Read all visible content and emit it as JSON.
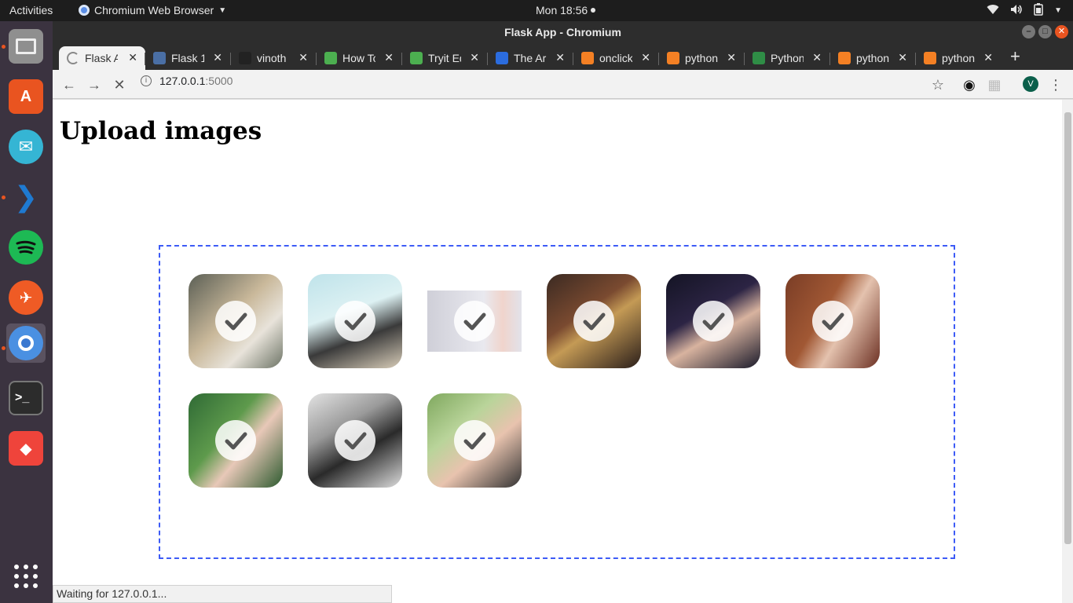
{
  "topbar": {
    "activities": "Activities",
    "app": "Chromium Web Browser",
    "clock": "Mon 18:56"
  },
  "dock": {
    "items": [
      {
        "name": "files",
        "color": "#8a8a8a"
      },
      {
        "name": "software",
        "color": "#e95420"
      },
      {
        "name": "mail",
        "color": "#35b5d4"
      },
      {
        "name": "vscode",
        "color": "#1f7ad1"
      },
      {
        "name": "spotify",
        "color": "#1db954"
      },
      {
        "name": "postman",
        "color": "#ef5b25"
      },
      {
        "name": "chromium",
        "color": "#4a90e2"
      },
      {
        "name": "terminal",
        "color": "#2c2c2c"
      },
      {
        "name": "anydesk",
        "color": "#ef443b"
      }
    ]
  },
  "window": {
    "title": "Flask App - Chromium"
  },
  "tabs": [
    {
      "label": "Flask A",
      "icon": "spinner-icon",
      "color": "#888"
    },
    {
      "label": "Flask 1",
      "icon": "hexagon-icon",
      "color": "#4a6fa5"
    },
    {
      "label": "vinoth",
      "icon": "github-icon",
      "color": "#222"
    },
    {
      "label": "How To",
      "icon": "w3-icon",
      "color": "#4caf50"
    },
    {
      "label": "Tryit Ed",
      "icon": "w3-icon",
      "color": "#4caf50"
    },
    {
      "label": "The Ar",
      "icon": "h-icon",
      "color": "#2b6cde"
    },
    {
      "label": "onclick",
      "icon": "stackoverflow-icon",
      "color": "#f48024"
    },
    {
      "label": "python",
      "icon": "stackoverflow-icon",
      "color": "#f48024"
    },
    {
      "label": "Python",
      "icon": "gfg-icon",
      "color": "#2f8d46"
    },
    {
      "label": "python",
      "icon": "stackoverflow-icon",
      "color": "#f48024"
    },
    {
      "label": "python",
      "icon": "stackoverflow-icon",
      "color": "#f48024"
    }
  ],
  "omnibox": {
    "host": "127.0.0.1",
    "port": ":5000"
  },
  "profile": {
    "initial": "V"
  },
  "page": {
    "heading": "Upload images"
  },
  "images": [
    {
      "bg": "linear-gradient(135deg,#5b5f55,#c9b89a 45%,#e8e3da 70%,#6d7466)"
    },
    {
      "bg": "linear-gradient(160deg,#bfe3ea,#ddf1f3 40%,#3a3a3a 65%,#d7ccb8)"
    },
    {
      "bg": "linear-gradient(90deg,#cfcfd8,#e9e9ef 60%,#f0d4cc 80%,#e2e2ea)",
      "card": true
    },
    {
      "bg": "linear-gradient(145deg,#3b2a22,#7a4a30 40%,#c49a55 55%,#2a1e1a)"
    },
    {
      "bg": "linear-gradient(150deg,#141424,#2c2444 40%,#d8b39f 60%,#1a1a2a)"
    },
    {
      "bg": "linear-gradient(120deg,#7a3d26,#a15834 40%,#e4c2ae 60%,#6b2f22)"
    },
    {
      "bg": "linear-gradient(130deg,#2f6a35,#5e9a4c 40%,#e8c8b8 60%,#2d5a2f)"
    },
    {
      "bg": "linear-gradient(150deg,#e3e3e3,#9a9a9a 35%,#2a2a2a 60%,#dcdcdc)"
    },
    {
      "bg": "linear-gradient(140deg,#7fa85e,#b9d49a 35%,#e8c3ae 60%,#333)"
    }
  ],
  "status": {
    "text": "Waiting for 127.0.0.1..."
  }
}
